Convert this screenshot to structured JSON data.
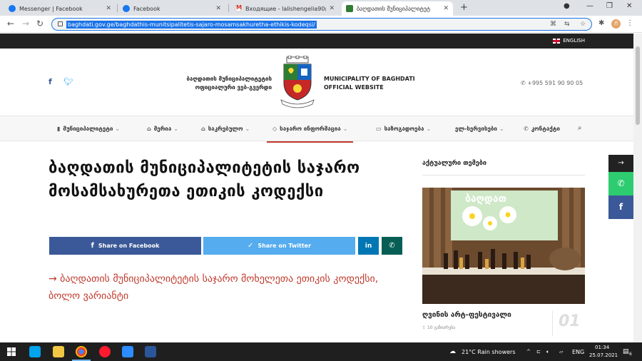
{
  "browser": {
    "tabs": [
      {
        "label": "Messenger | Facebook",
        "icon": "facebook-icon"
      },
      {
        "label": "Facebook",
        "icon": "facebook-icon"
      },
      {
        "label": "Входящие - lalishengelia90@gm",
        "icon": "gmail-icon"
      },
      {
        "label": "ბაღდათის მუნიციპალიტეტ",
        "icon": "municipality-icon",
        "active": true
      }
    ],
    "new_tab": "+",
    "url": "baghdati.gov.ge/baghdathis-munitsipalitetis-sajaro-mosamsakhuretha-ethikis-kodeqsi/",
    "profile_initial": "Л"
  },
  "site": {
    "language": "ENGLISH",
    "brand_ka_line1": "ბაღდათის მუნიციპალიტეტის",
    "brand_ka_line2": "ოფიციალური ვებ-გვერდი",
    "brand_en_line1": "MUNICIPALITY OF BAGHDATI",
    "brand_en_line2": "OFFICIAL WEBSITE",
    "phone": "+995 591 90 90 05",
    "nav": [
      {
        "label": "მუნიციპალიტეტი",
        "icon": "flag-icon"
      },
      {
        "label": "მერია",
        "icon": "building-icon"
      },
      {
        "label": "საკრებულო",
        "icon": "council-icon"
      },
      {
        "label": "საჯარო ინფორმაცია",
        "icon": "info-icon",
        "active": true
      },
      {
        "label": "საზოგადოება",
        "icon": "monitor-icon"
      },
      {
        "label": "ელ-სერვისები",
        "icon": ""
      },
      {
        "label": "კონტაქტი",
        "icon": "phone-icon"
      }
    ],
    "title": "ბაღდათის მუნიციპალიტეტის საჯარო მოსამსახურეთა ეთიკის კოდექსი",
    "share": {
      "facebook": "Share on Facebook",
      "twitter": "Share on Twitter"
    },
    "doc_link": "→ ბაღდათის მუნიციპალიტეტის საჯარო მოხელეთა ეთიკის კოდექსი, ბოლო ვარიანტი",
    "sidebar": {
      "heading": "აქტუალური თემები",
      "photo_caption": "ბაღდათ",
      "card_title": "ღვინის არტ-ფესტივალი",
      "card_meta": "10 გაზიარება",
      "card_number": "01"
    }
  },
  "taskbar": {
    "weather": "21°C  Rain showers",
    "lang": "ENG",
    "time": "01:34",
    "date": "25.07.2021",
    "notifications": "6"
  },
  "colors": {
    "accent_red": "#c0392b",
    "facebook": "#3b5998",
    "twitter": "#55acee",
    "linkedin": "#0077b5",
    "whatsapp": "#075e54",
    "call_green": "#2ecc71"
  }
}
